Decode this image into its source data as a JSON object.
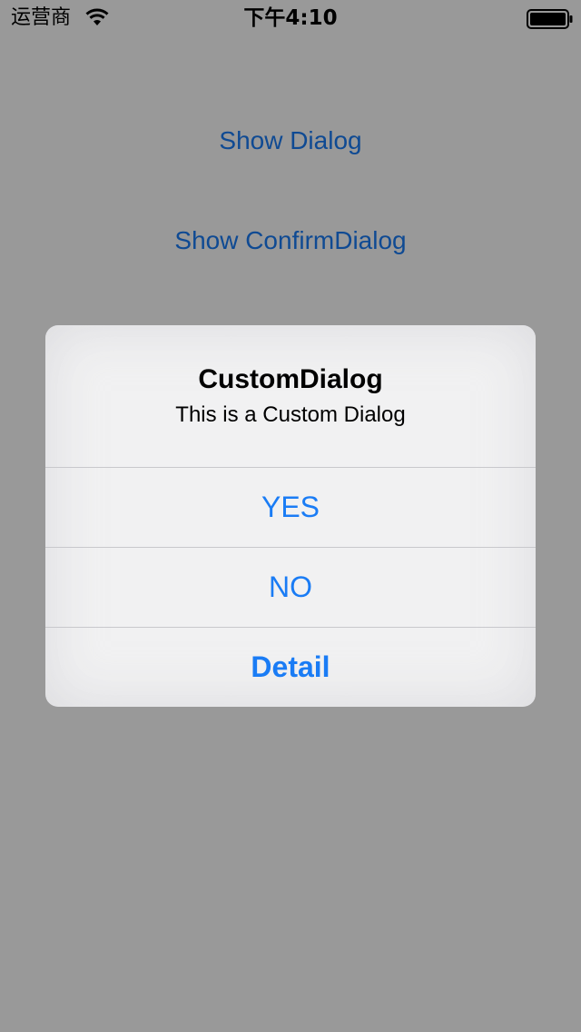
{
  "status_bar": {
    "carrier": "运营商",
    "time": "下午4:10",
    "wifi_icon": "wifi-icon",
    "battery_icon": "battery-full-icon"
  },
  "page": {
    "buttons": [
      "Show Dialog",
      "Show ConfirmDialog"
    ]
  },
  "dialog": {
    "title": "CustomDialog",
    "message": "This is a Custom Dialog",
    "buttons": {
      "yes": "YES",
      "no": "NO",
      "detail": "Detail"
    }
  },
  "colors": {
    "accent": "#1a7cf5",
    "overlay": "rgba(0,0,0,0.4)",
    "dialog_background": "#f6f6f8"
  }
}
